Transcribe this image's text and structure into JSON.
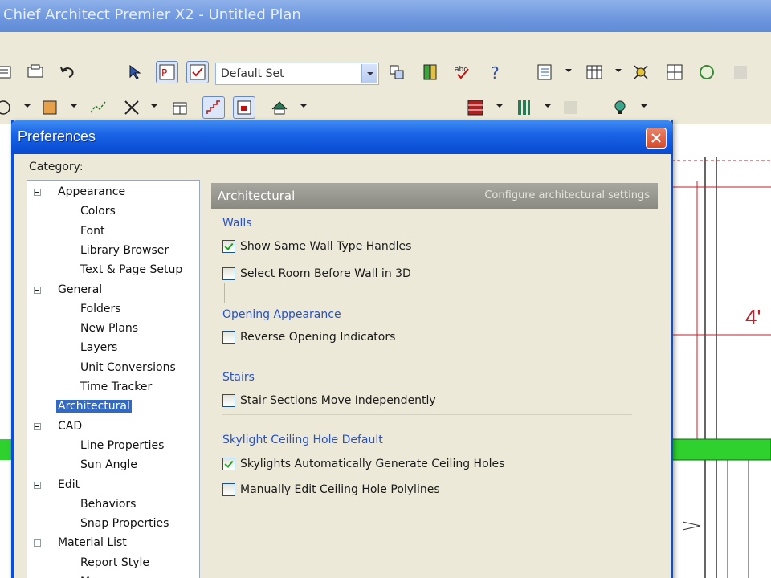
{
  "app": {
    "window_title": "Chief Architect Premier X2 - Untitled Plan"
  },
  "toolbar": {
    "default_set_value": "Default Set"
  },
  "canvas": {
    "dimension_label": "4'"
  },
  "dialog": {
    "title": "Preferences",
    "category_label": "Category:",
    "tree": [
      {
        "label": "Appearance",
        "level": 0
      },
      {
        "label": "Colors",
        "level": 1
      },
      {
        "label": "Font",
        "level": 1
      },
      {
        "label": "Library Browser",
        "level": 1
      },
      {
        "label": "Text & Page Setup",
        "level": 1
      },
      {
        "label": "General",
        "level": 0
      },
      {
        "label": "Folders",
        "level": 1
      },
      {
        "label": "New Plans",
        "level": 1
      },
      {
        "label": "Layers",
        "level": 1
      },
      {
        "label": "Unit Conversions",
        "level": 1
      },
      {
        "label": "Time Tracker",
        "level": 1
      },
      {
        "label": "Architectural",
        "level": 0,
        "selected": true
      },
      {
        "label": "CAD",
        "level": 0
      },
      {
        "label": "Line Properties",
        "level": 1
      },
      {
        "label": "Sun Angle",
        "level": 1
      },
      {
        "label": "Edit",
        "level": 0
      },
      {
        "label": "Behaviors",
        "level": 1
      },
      {
        "label": "Snap Properties",
        "level": 1
      },
      {
        "label": "Material List",
        "level": 0
      },
      {
        "label": "Report Style",
        "level": 1
      },
      {
        "label": "Messages",
        "level": 1
      }
    ],
    "panel": {
      "header_title": "Architectural",
      "header_subtitle": "Configure architectural settings",
      "groups": [
        {
          "title": "Walls",
          "options": [
            {
              "label": "Show Same Wall Type Handles",
              "checked": true
            },
            {
              "label": "Select Room Before Wall in 3D",
              "checked": false
            }
          ]
        },
        {
          "title": "Opening Appearance",
          "options": [
            {
              "label": "Reverse Opening Indicators",
              "checked": false
            }
          ]
        },
        {
          "title": "Stairs",
          "options": [
            {
              "label": "Stair Sections Move Independently",
              "checked": false
            }
          ]
        },
        {
          "title": "Skylight Ceiling Hole Default",
          "options": [
            {
              "label": "Skylights Automatically Generate Ceiling Holes",
              "checked": true
            },
            {
              "label": "Manually Edit Ceiling Hole Polylines",
              "checked": false
            }
          ]
        }
      ]
    }
  },
  "colors": {
    "title_blue": "#0a4fd6",
    "selection_blue": "#3169c6",
    "group_title_blue": "#2752c8",
    "canvas_red": "#c0202a",
    "wall_green": "#2fd12f"
  }
}
